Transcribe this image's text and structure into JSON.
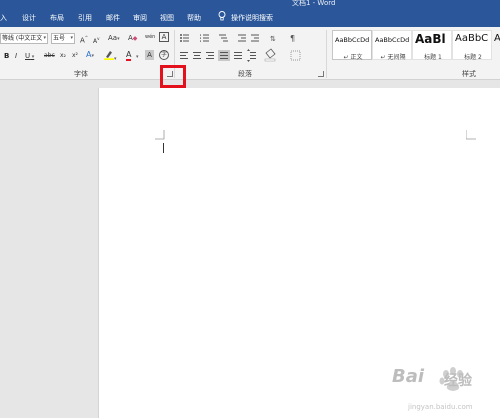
{
  "window": {
    "title": "文档1 - Word"
  },
  "tabs": [
    "入",
    "设计",
    "布局",
    "引用",
    "邮件",
    "审阅",
    "视图",
    "帮助",
    "操作说明搜索"
  ],
  "font_group": {
    "font_name": "等线 (中文正文",
    "font_size": "五号",
    "grow": "A",
    "shrink": "A",
    "case": "Aa",
    "clear_format": "A",
    "phonetic": "wén",
    "char_border": "A",
    "bold": "B",
    "italic": "I",
    "underline": "U",
    "strikethrough": "abc",
    "subscript": "x₂",
    "superscript": "x²",
    "text_effect": "A",
    "font_color": "A",
    "char_shading": "A",
    "enclose": "字",
    "label": "字体"
  },
  "paragraph_group": {
    "label": "段落"
  },
  "styles_group": {
    "label": "样式",
    "styles": [
      {
        "sample": "AaBbCcDd",
        "name": "↵ 正文"
      },
      {
        "sample": "AaBbCcDd",
        "name": "↵ 无间隔"
      },
      {
        "sample": "AaBl",
        "name": "标题 1"
      },
      {
        "sample": "AaBbC",
        "name": "标题 2"
      },
      {
        "sample": "A",
        "name": ""
      }
    ]
  },
  "watermark": {
    "brand": "Bai",
    "brand2": "经验",
    "url": "jingyan.baidu.com"
  },
  "colors": {
    "ribbon_blue": "#2b579a",
    "highlight_red": "#e3111b",
    "font_color_red": "#e81123",
    "highlighter_yellow": "#ffff00"
  }
}
